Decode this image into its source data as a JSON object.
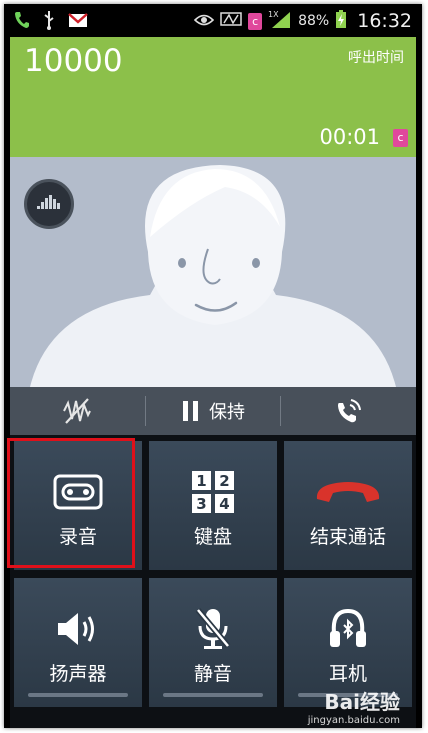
{
  "status_bar": {
    "battery": "88%",
    "time": "16:32",
    "network": "1X",
    "carrier_badge": "c"
  },
  "call": {
    "number": "10000",
    "call_type": "呼出时间",
    "duration": "00:01",
    "sim_badge": "c"
  },
  "quick_bar": {
    "hold_label": "保持"
  },
  "tiles": [
    {
      "label": "录音",
      "icon": "record-icon"
    },
    {
      "label": "键盘",
      "icon": "keypad-icon"
    },
    {
      "label": "结束通话",
      "icon": "end-call-icon"
    },
    {
      "label": "扬声器",
      "icon": "speaker-icon"
    },
    {
      "label": "静音",
      "icon": "mute-icon"
    },
    {
      "label": "耳机",
      "icon": "bluetooth-headset-icon"
    }
  ],
  "keypad_digits": [
    "1",
    "2",
    "3",
    "4"
  ],
  "watermark": {
    "brand": "Bai经验",
    "url": "jingyan.baidu.com"
  },
  "colors": {
    "call_header": "#8cc04a",
    "tile": "#34424f",
    "end_call": "#d9332b",
    "highlight": "#e0101a",
    "sim_badge": "#e0489c"
  }
}
